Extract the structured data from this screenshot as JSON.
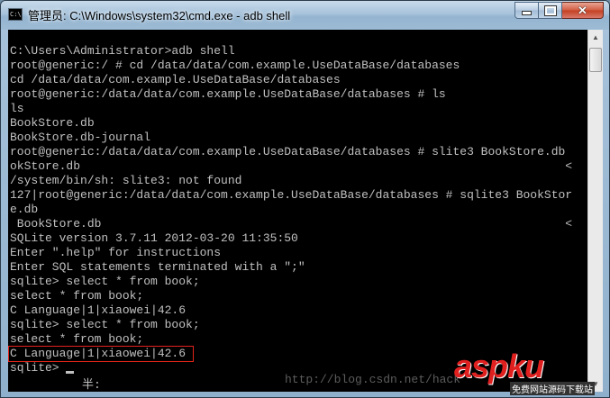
{
  "window": {
    "title": "管理员: C:\\Windows\\system32\\cmd.exe - adb  shell",
    "icon": "cmd-icon"
  },
  "console": {
    "lines": [
      "C:\\Users\\Administrator>adb shell",
      "root@generic:/ # cd /data/data/com.example.UseDataBase/databases",
      "cd /data/data/com.example.UseDataBase/databases",
      "root@generic:/data/data/com.example.UseDataBase/databases # ls",
      "ls",
      "BookStore.db",
      "BookStore.db-journal",
      "root@generic:/data/data/com.example.UseDataBase/databases # slite3 BookStore.db",
      "okStore.db                                                                     <",
      "/system/bin/sh: slite3: not found",
      "127|root@generic:/data/data/com.example.UseDataBase/databases # sqlite3 BookStor",
      "e.db",
      " BookStore.db                                                                  <",
      "SQLite version 3.7.11 2012-03-20 11:35:50",
      "Enter \".help\" for instructions",
      "Enter SQL statements terminated with a \";\"",
      "sqlite> select * from book;",
      "select * from book;",
      "C Language|1|xiaowei|42.6",
      "sqlite> select * from book;",
      "select * from book;",
      "C Language|1|xiaowei|42.6",
      "sqlite>"
    ],
    "ime_indicator": "半:"
  },
  "watermark": {
    "url": "http://blog.csdn.net/hack",
    "logo": "aspku",
    "logo_sub": "免费网站源码下载站"
  },
  "colors": {
    "console_bg": "#000000",
    "console_text": "#c0c0c0",
    "highlight": "#e2231a"
  }
}
